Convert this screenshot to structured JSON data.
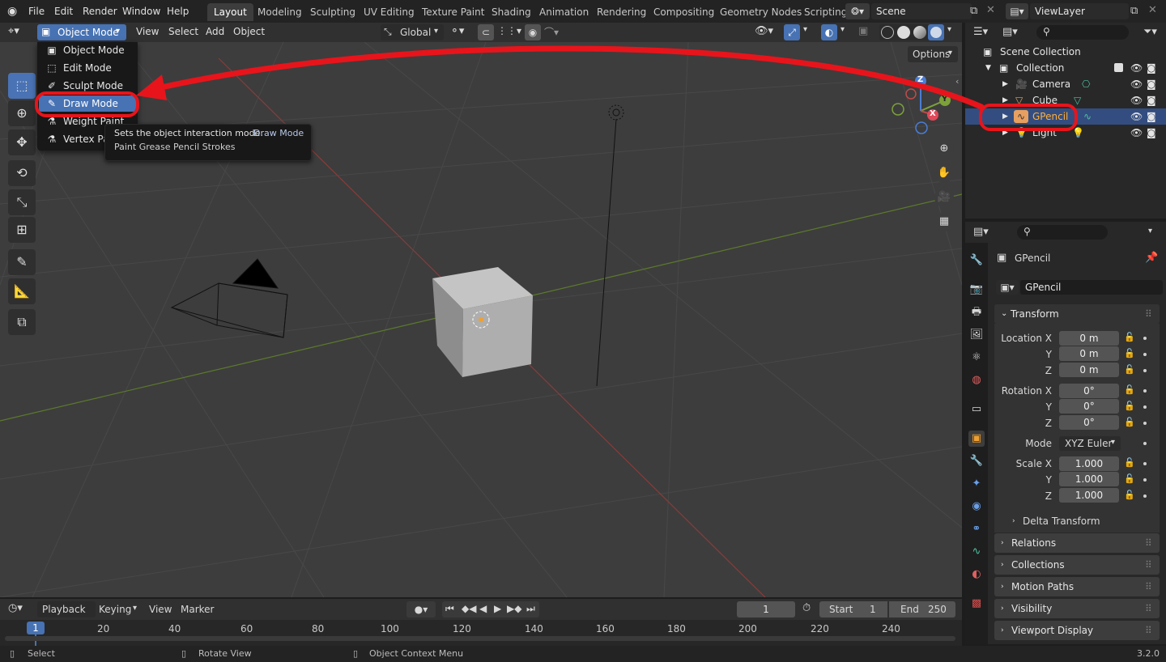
{
  "topbar": {
    "menus": [
      "File",
      "Edit",
      "Render",
      "Window",
      "Help"
    ],
    "workspaces": [
      "Layout",
      "Modeling",
      "Sculpting",
      "UV Editing",
      "Texture Paint",
      "Shading",
      "Animation",
      "Rendering",
      "Compositing",
      "Geometry Nodes",
      "Scripting"
    ],
    "active_workspace": "Layout",
    "scene": "Scene",
    "view_layer": "ViewLayer"
  },
  "viewport_header": {
    "mode": "Object Mode",
    "menus": [
      "View",
      "Select",
      "Add",
      "Object"
    ],
    "orientation": "Global",
    "options": "Options"
  },
  "mode_menu": {
    "items": [
      "Object Mode",
      "Edit Mode",
      "Sculpt Mode",
      "Draw Mode",
      "Weight Paint",
      "Vertex Paint"
    ],
    "highlighted": "Draw Mode"
  },
  "tooltip": {
    "line1": "Sets the object interaction mode:",
    "line1_value": "Draw Mode",
    "line2": "Paint Grease Pencil Strokes"
  },
  "gizmo": {
    "x": "X",
    "y": "Y",
    "z": "Z"
  },
  "timeline": {
    "menus": [
      "Playback",
      "Keying",
      "View",
      "Marker"
    ],
    "current_frame": "1",
    "start_label": "Start",
    "start": "1",
    "end_label": "End",
    "end": "250",
    "ticks": [
      "1",
      "20",
      "40",
      "60",
      "80",
      "100",
      "120",
      "140",
      "160",
      "180",
      "200",
      "220",
      "240"
    ]
  },
  "statusbar": {
    "select": "Select",
    "rotate": "Rotate View",
    "context": "Object Context Menu",
    "version": "3.2.0"
  },
  "outliner": {
    "root": "Scene Collection",
    "collection": "Collection",
    "items": [
      "Camera",
      "Cube",
      "GPencil",
      "Light"
    ],
    "selected": "GPencil"
  },
  "properties": {
    "object_name": "GPencil",
    "data_name": "GPencil",
    "transform_title": "Transform",
    "location_label": "Location X",
    "location": [
      "0 m",
      "0 m",
      "0 m"
    ],
    "rotation_label": "Rotation X",
    "rotation": [
      "0°",
      "0°",
      "0°"
    ],
    "mode_label": "Mode",
    "mode": "XYZ Euler",
    "scale_label": "Scale X",
    "scale": [
      "1.000",
      "1.000",
      "1.000"
    ],
    "y_label": "Y",
    "z_label": "Z",
    "delta": "Delta Transform",
    "panels": [
      "Relations",
      "Collections",
      "Motion Paths",
      "Visibility",
      "Viewport Display"
    ]
  },
  "colors": {
    "accent": "#4772b3",
    "annotation": "#e8141b",
    "x_axis": "#c14a4a",
    "y_axis": "#7ca13a"
  }
}
